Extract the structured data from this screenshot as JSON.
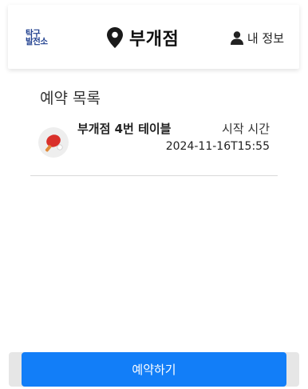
{
  "header": {
    "logo_line1": "탁구",
    "logo_line2": "발전소",
    "location_icon": "map-pin-icon",
    "location_name": "부개점",
    "user_icon": "user-icon",
    "user_label": "내 정보"
  },
  "main": {
    "section_title": "예약 목록",
    "reservations": [
      {
        "icon": "ping-pong-icon",
        "title": "부개점 4번 테이블",
        "start_label": "시작 시간",
        "start_time": "2024-11-16T15:55"
      }
    ]
  },
  "footer": {
    "reserve_label": "예약하기",
    "accent_color": "#127ef8"
  }
}
